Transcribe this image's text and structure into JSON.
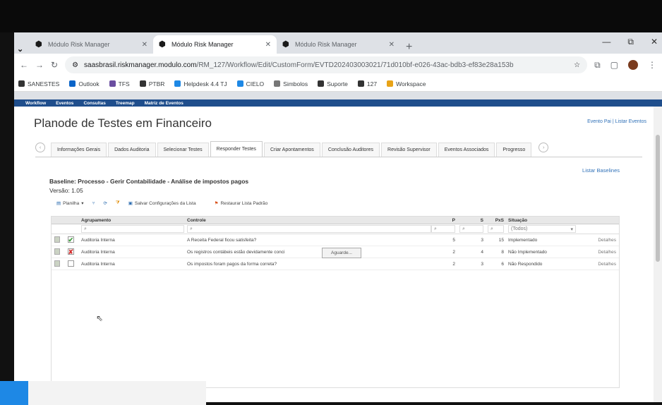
{
  "browser": {
    "tabs": [
      {
        "title": "Módulo Risk Manager",
        "active": false
      },
      {
        "title": "Módulo Risk Manager",
        "active": true
      },
      {
        "title": "Módulo Risk Manager",
        "active": false
      }
    ],
    "new_tab": "+",
    "window_controls": {
      "minimize": "—",
      "restore": "⧉",
      "close": "✕"
    },
    "url_domain": "saasbrasil.riskmanager.modulo.com",
    "url_path": "/RM_127/Workflow/Edit/CustomForm/EVTD202403003021/71d010bf-e026-43ac-bdb3-ef83e28a153b",
    "bookmarks": [
      "SANESTES",
      "Outlook",
      "TFS",
      "PTBR",
      "Helpdesk 4.4 TJ",
      "CIELO",
      "Simbolos",
      "Suporte",
      "127",
      "Workspace"
    ]
  },
  "app_nav": [
    "Workflow",
    "Eventos",
    "Consultas",
    "Treemap",
    "Matriz de Eventos"
  ],
  "page": {
    "title": "Planode de Testes em Financeiro",
    "top_links": "Evento Pai | Listar Eventos",
    "form_tabs": [
      "Informações Gerais",
      "Dados Auditoria",
      "Selecionar Testes",
      "Responder Testes",
      "Criar Apontamentos",
      "Conclusão Auditores",
      "Revisão Supervisor",
      "Eventos Associados",
      "Progresso"
    ],
    "active_tab_index": 3,
    "baseline_label": "Baseline: Processo - Gerir Contabilidade - Análise de impostos pagos",
    "version_label": "Versão: 1.05",
    "list_baselines": "Listar Baselines"
  },
  "toolbar": {
    "planilha": "Planilha",
    "save_config": "Salvar Configurações da Lista",
    "restore_default": "Restaurar Lista Padrão"
  },
  "grid": {
    "headers": {
      "agrupamento": "Agrupamento",
      "controle": "Controle",
      "p": "P",
      "s": "S",
      "pxs": "PxS",
      "situacao": "Situação"
    },
    "filter_situacao": "(Todos)",
    "rows": [
      {
        "checked": "✔",
        "agrupamento": "Auditoria Interna",
        "controle": "A Receita Federal ficou satisfeita?",
        "p": "5",
        "s": "3",
        "pxs": "15",
        "situacao": "Implementado",
        "detalhes": "Detalhes"
      },
      {
        "checked": "✘",
        "agrupamento": "Auditoria Interna",
        "controle": "Os registros contábeis estão devidamente conci",
        "p": "2",
        "s": "4",
        "pxs": "8",
        "situacao": "Não Implementado",
        "detalhes": "Detalhes"
      },
      {
        "checked": "",
        "agrupamento": "Auditoria Interna",
        "controle": "Os impostos foram pagos da forma correta?",
        "p": "2",
        "s": "3",
        "pxs": "6",
        "situacao": "Não Respondido",
        "detalhes": "Detalhes"
      }
    ],
    "tooltip": "Aguarde..."
  },
  "colors": {
    "nav": "#1f4e8c",
    "link": "#3071b8",
    "check_green": "#3a9a3a",
    "check_red": "#d32f2f"
  }
}
